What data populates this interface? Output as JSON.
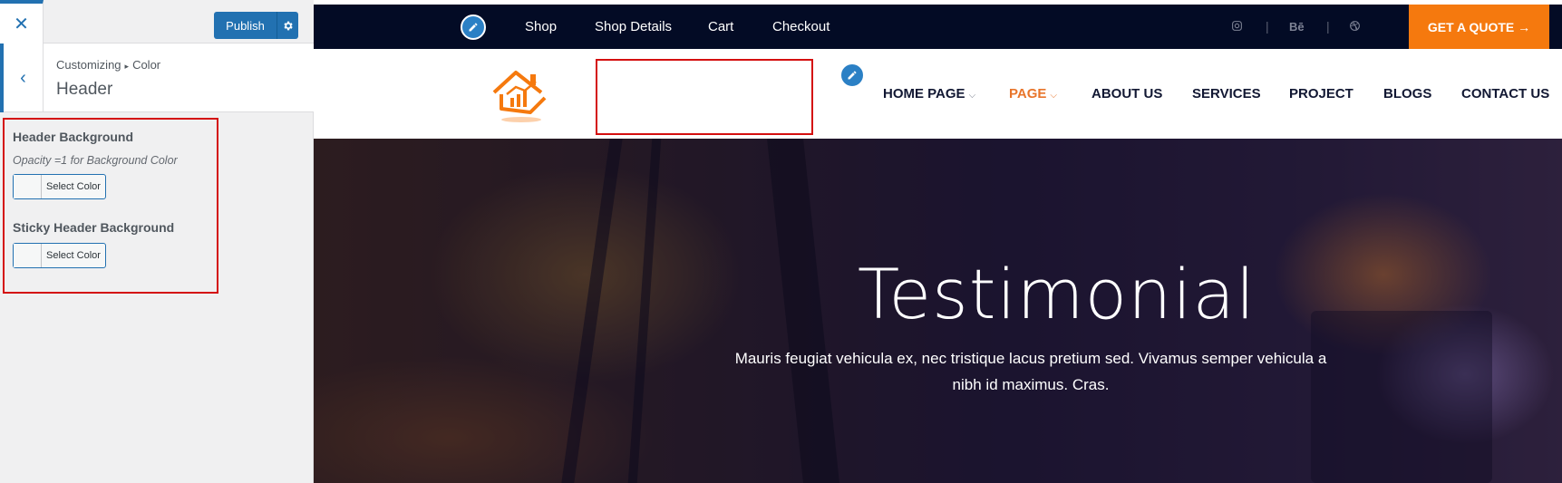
{
  "sidebar": {
    "close_icon": "close-icon",
    "publish_label": "Publish",
    "crumb_root": "Customizing",
    "crumb_current": "Color",
    "section_title": "Header",
    "controls": [
      {
        "label": "Header Background",
        "description": "Opacity =1 for Background Color",
        "button": "Select Color"
      },
      {
        "label": "Sticky Header Background",
        "button": "Select Color"
      }
    ]
  },
  "preview": {
    "topbar": {
      "links": [
        "Shop",
        "Shop Details",
        "Cart",
        "Checkout"
      ],
      "social": [
        "instagram-icon",
        "behance-icon",
        "dribbble-icon"
      ],
      "behance_text": "Bē",
      "quote_button": "GET A QUOTE →"
    },
    "nav": {
      "items": [
        "HOME PAGE",
        "PAGE",
        "ABOUT US",
        "SERVICES",
        "PROJECT",
        "BLOGS",
        "CONTACT US"
      ],
      "active": "PAGE"
    },
    "hero": {
      "title": "Testimonial",
      "text": "Mauris feugiat vehicula ex, nec tristique lacus pretium sed. Vivamus semper vehicula a nibh id maximus. Cras."
    },
    "colors": {
      "topbar_bg": "#030b25",
      "accent": "#f5790e",
      "wp_blue": "#2271b1",
      "highlight_red": "#d40f0f"
    }
  }
}
